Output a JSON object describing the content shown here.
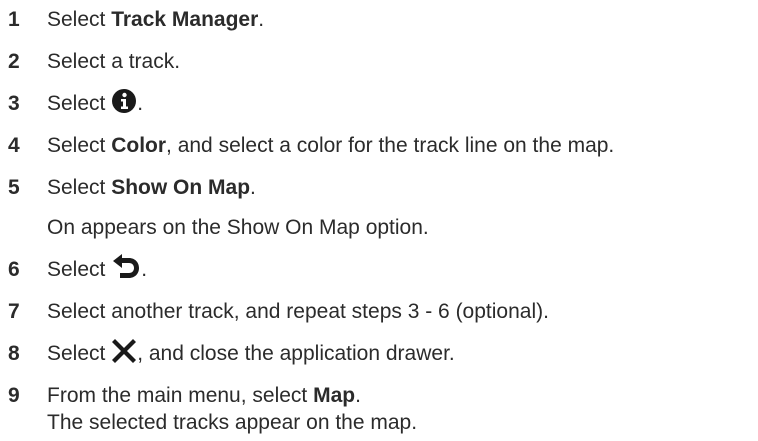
{
  "steps": [
    {
      "num": "1",
      "pre": "Select ",
      "bold": "Track Manager",
      "post": "."
    },
    {
      "num": "2",
      "pre": "Select a track.",
      "bold": "",
      "post": ""
    },
    {
      "num": "3",
      "pre": "Select ",
      "icon": "info-icon",
      "post": "."
    },
    {
      "num": "4",
      "pre": "Select ",
      "bold": "Color",
      "post": ", and select a color for the track line on the map."
    },
    {
      "num": "5",
      "pre": "Select ",
      "bold": "Show On Map",
      "post": ".",
      "note": "On appears on the Show On Map option."
    },
    {
      "num": "6",
      "pre": "Select ",
      "icon": "back-arrow-icon",
      "post": "."
    },
    {
      "num": "7",
      "pre": "Select another track, and repeat steps 3 - 6 (optional).",
      "bold": "",
      "post": ""
    },
    {
      "num": "8",
      "pre": "Select ",
      "icon": "close-x-icon",
      "post": ", and close the application drawer."
    },
    {
      "num": "9",
      "pre": "From the main menu, select ",
      "bold": "Map",
      "post": ".",
      "note": "The selected tracks appear on the map."
    }
  ]
}
